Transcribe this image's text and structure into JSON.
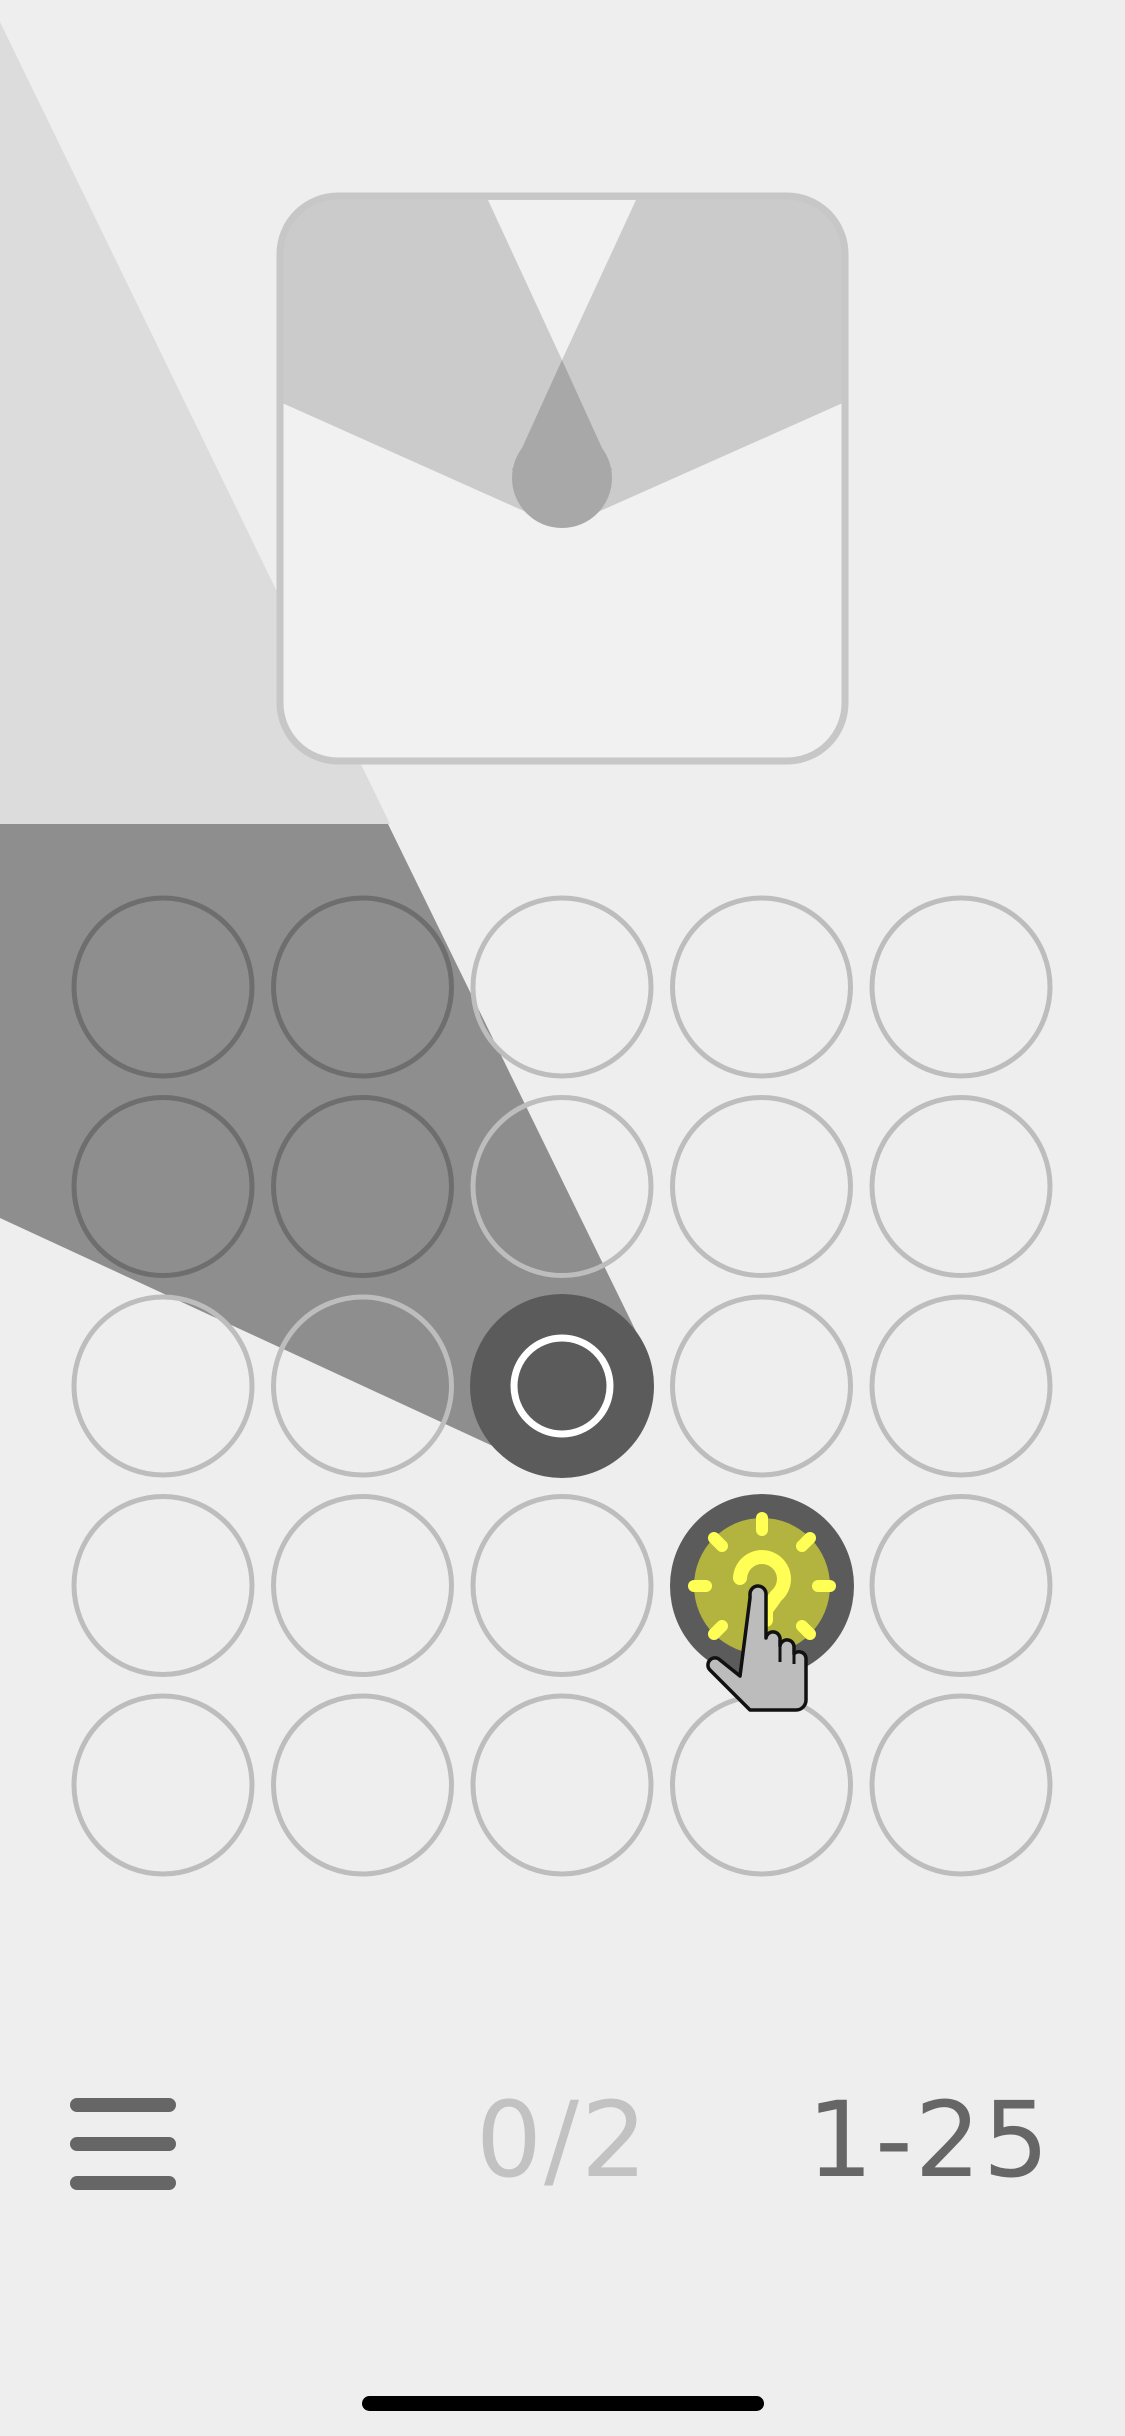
{
  "game": {
    "progress_label": "0/2",
    "level_label": "1-25",
    "grid": {
      "rows": 5,
      "cols": 5,
      "lamp": {
        "row": 2,
        "col": 2
      },
      "hint": {
        "row": 3,
        "col": 3
      }
    }
  },
  "icons": {
    "menu": "hamburger-menu-icon",
    "hint": "lightbulb-hint-icon",
    "pointer": "pointing-hand-icon",
    "lamp": "ring-lamp-icon"
  },
  "colors": {
    "background": "#eeeeee",
    "cell_stroke": "#bdbdbd",
    "lamp_fill": "#5b5b5b",
    "light_cone": "#8e8e8e",
    "hint_glow": "#ffff55",
    "text_primary": "#666666",
    "text_muted": "#c2c2c2"
  }
}
